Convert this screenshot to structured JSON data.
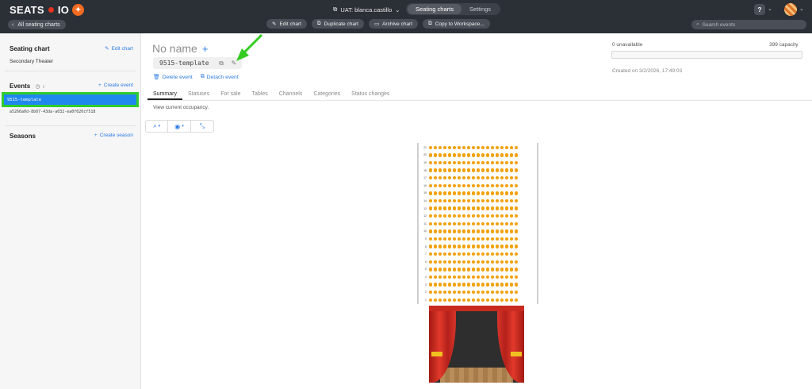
{
  "brand": {
    "logo_text_left": "SEATS",
    "logo_text_right": "IO"
  },
  "topbar": {
    "back_label": "All seating charts",
    "workspace_label": "UAT: blanca.castillo",
    "tabs": [
      {
        "label": "Seating charts"
      },
      {
        "label": "Settings"
      }
    ],
    "toolbar": {
      "edit_chart": "Edit chart",
      "duplicate_chart": "Duplicate chart",
      "archive_chart": "Archive chart",
      "copy_to_workspace": "Copy to Workspace..."
    },
    "help_label": "?",
    "search_placeholder": "Search events"
  },
  "sidebar": {
    "seating_chart": {
      "title": "Seating chart",
      "link": "Edit chart",
      "value": "Secondary Theater"
    },
    "events": {
      "title": "Events",
      "link": "Create event",
      "items": [
        {
          "label": "9515-template"
        },
        {
          "label": "a5266a0d-8b07-43da-a032-ea0f026cf518"
        }
      ]
    },
    "seasons": {
      "title": "Seasons",
      "link": "Create season"
    }
  },
  "main": {
    "title": "No name",
    "event_key": "9515-template",
    "actions": {
      "delete": "Delete event",
      "detach": "Detach event"
    },
    "tabs": [
      {
        "label": "Summary"
      },
      {
        "label": "Statuses"
      },
      {
        "label": "For sale"
      },
      {
        "label": "Tables"
      },
      {
        "label": "Channels"
      },
      {
        "label": "Categories"
      },
      {
        "label": "Status changes"
      }
    ],
    "occupancy_text": "View current occupancy.",
    "stats": {
      "unavailable": "0 unavailable",
      "capacity": "399 capacity",
      "created": "Created on 3/2/2026, 17:49:03"
    }
  },
  "seating": {
    "rows": [
      "21",
      "20",
      "19",
      "18",
      "17",
      "16",
      "15",
      "14",
      "13",
      "12",
      "11",
      "10",
      "9",
      "8",
      "7",
      "6",
      "5",
      "4",
      "3",
      "2",
      "1"
    ],
    "seats_per_row": 19,
    "seat_color": "#f2a10d"
  },
  "colors": {
    "accent": "#2a7be4",
    "selected_event": "#1e88ee",
    "highlight": "#2fcc2f",
    "topbar": "#2b2f36"
  },
  "icons": [
    "chevron-left-icon",
    "copy-icon",
    "chevron-down-icon",
    "pencil-icon",
    "duplicate-icon",
    "archive-icon",
    "search-icon",
    "clock-icon",
    "plus-icon",
    "trash-icon",
    "detach-icon",
    "eye-icon",
    "expand-icon"
  ]
}
